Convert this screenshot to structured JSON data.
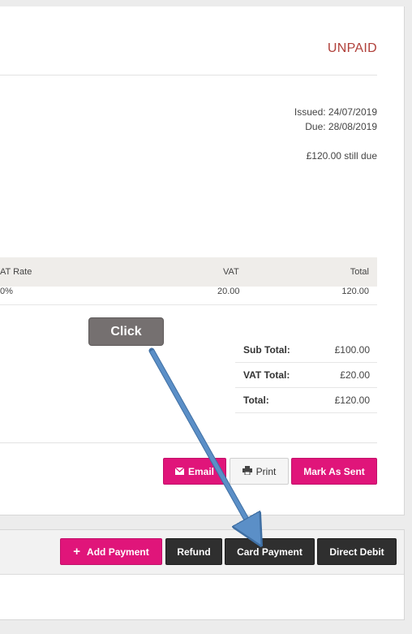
{
  "invoice": {
    "status": "UNPAID",
    "issued": "Issued: 24/07/2019",
    "due": "Due: 28/08/2019",
    "still_due": "£120.00 still due"
  },
  "table": {
    "headers": {
      "vat_rate": "AT Rate",
      "vat": "VAT",
      "total": "Total"
    },
    "row": {
      "vat_rate": "0%",
      "vat": "20.00",
      "total": "120.00"
    }
  },
  "totals": [
    {
      "label": "Sub Total:",
      "value": "£100.00"
    },
    {
      "label": "VAT Total:",
      "value": "£20.00"
    },
    {
      "label": "Total:",
      "value": "£120.00"
    }
  ],
  "actions": {
    "email": "Email",
    "print": "Print",
    "mark_sent": "Mark As Sent"
  },
  "payments": {
    "add_payment": "Add Payment",
    "refund": "Refund",
    "card_payment": "Card Payment",
    "direct_debit": "Direct Debit"
  },
  "annotation": {
    "callout": "Click",
    "arrow_color": "#5b8fc7"
  },
  "colors": {
    "accent": "#e0157a",
    "status": "#b0403a",
    "dark_button": "#2f2f2f"
  }
}
